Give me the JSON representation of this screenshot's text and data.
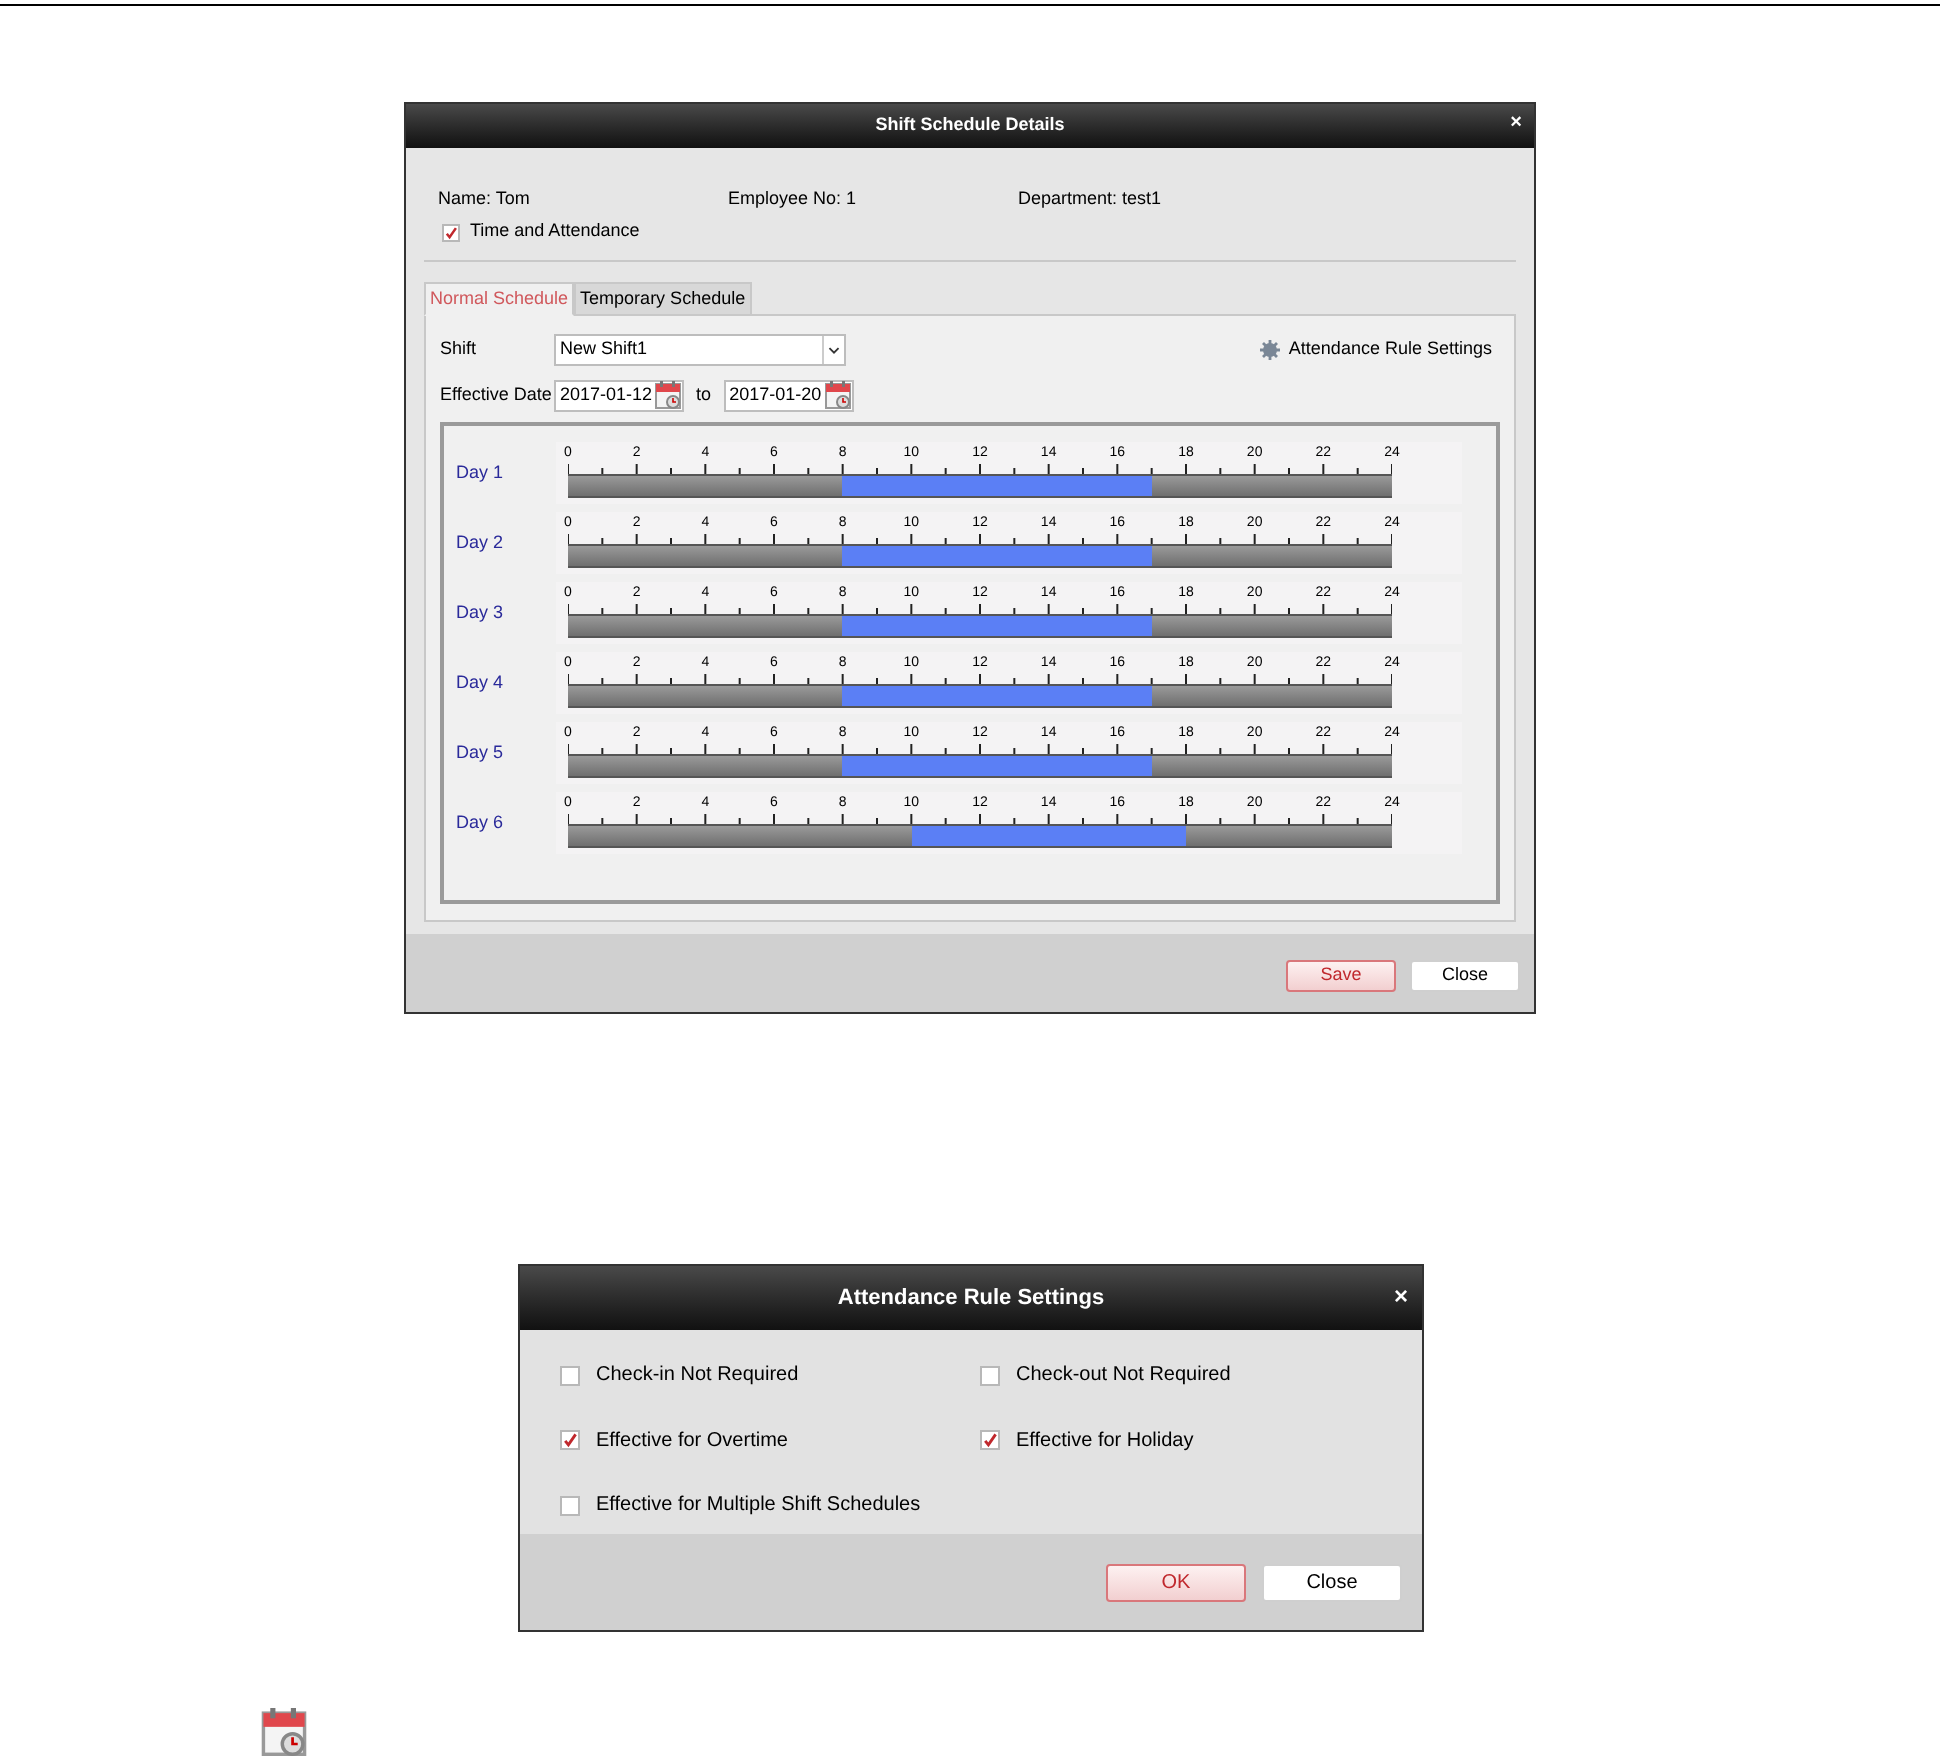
{
  "shift_dialog": {
    "title": "Shift Schedule Details",
    "close_glyph": "×",
    "name": "Name: Tom",
    "employee_no": "Employee No: 1",
    "department": "Department: test1",
    "time_and_attendance": {
      "label": "Time and Attendance",
      "checked": true
    },
    "tabs": [
      {
        "label": "Normal Schedule",
        "selected": true
      },
      {
        "label": "Temporary Schedule",
        "selected": false
      }
    ],
    "shift": {
      "label": "Shift",
      "value": "New Shift1"
    },
    "attendance_rule_link": "Attendance Rule Settings",
    "effective_date": {
      "label": "Effective Date",
      "from": "2017-01-12",
      "to_label": "to",
      "to": "2017-01-20"
    },
    "days": [
      {
        "label": "Day 1",
        "shift_start": {
          "level": 0.3333
        },
        "shift_end": {
          "level": 0.7083
        },
        "ticks": [
          "0",
          "2",
          "4",
          "6",
          "8",
          "10",
          "12",
          "14",
          "16",
          "18",
          "20",
          "22",
          "24"
        ]
      },
      {
        "label": "Day 2",
        "shift_start": {
          "level": 0.3333
        },
        "shift_end": {
          "level": 0.7083
        },
        "ticks": [
          "0",
          "2",
          "4",
          "6",
          "8",
          "10",
          "12",
          "14",
          "16",
          "18",
          "20",
          "22",
          "24"
        ]
      },
      {
        "label": "Day 3",
        "shift_start": {
          "level": 0.3333
        },
        "shift_end": {
          "level": 0.7083
        },
        "ticks": [
          "0",
          "2",
          "4",
          "6",
          "8",
          "10",
          "12",
          "14",
          "16",
          "18",
          "20",
          "22",
          "24"
        ]
      },
      {
        "label": "Day 4",
        "shift_start": {
          "level": 0.3333
        },
        "shift_end": {
          "level": 0.7083
        },
        "ticks": [
          "0",
          "2",
          "4",
          "6",
          "8",
          "10",
          "12",
          "14",
          "16",
          "18",
          "20",
          "22",
          "24"
        ]
      },
      {
        "label": "Day 5",
        "shift_start": {
          "level": 0.3333
        },
        "shift_end": {
          "level": 0.7083
        },
        "ticks": [
          "0",
          "2",
          "4",
          "6",
          "8",
          "10",
          "12",
          "14",
          "16",
          "18",
          "20",
          "22",
          "24"
        ]
      },
      {
        "label": "Day 6",
        "shift_start": {
          "level": 0.4167
        },
        "shift_end": {
          "level": 0.75
        },
        "ticks": [
          "0",
          "2",
          "4",
          "6",
          "8",
          "10",
          "12",
          "14",
          "16",
          "18",
          "20",
          "22",
          "24"
        ]
      }
    ],
    "buttons": [
      {
        "label": "Save",
        "kind": "primary"
      },
      {
        "label": "Close",
        "kind": "normal"
      }
    ]
  },
  "rule_dialog": {
    "title": "Attendance Rule Settings",
    "close_glyph": "×",
    "options": [
      {
        "label": "Check-in Not Required",
        "checked": false
      },
      {
        "label": "Check-out Not Required",
        "checked": false
      },
      {
        "label": "Effective for Overtime",
        "checked": true
      },
      {
        "label": "Effective for Holiday",
        "checked": true
      },
      {
        "label": "Effective for Multiple Shift Schedules",
        "checked": false
      }
    ],
    "buttons": [
      {
        "label": "OK",
        "kind": "primary"
      },
      {
        "label": "Close",
        "kind": "normal"
      }
    ]
  }
}
